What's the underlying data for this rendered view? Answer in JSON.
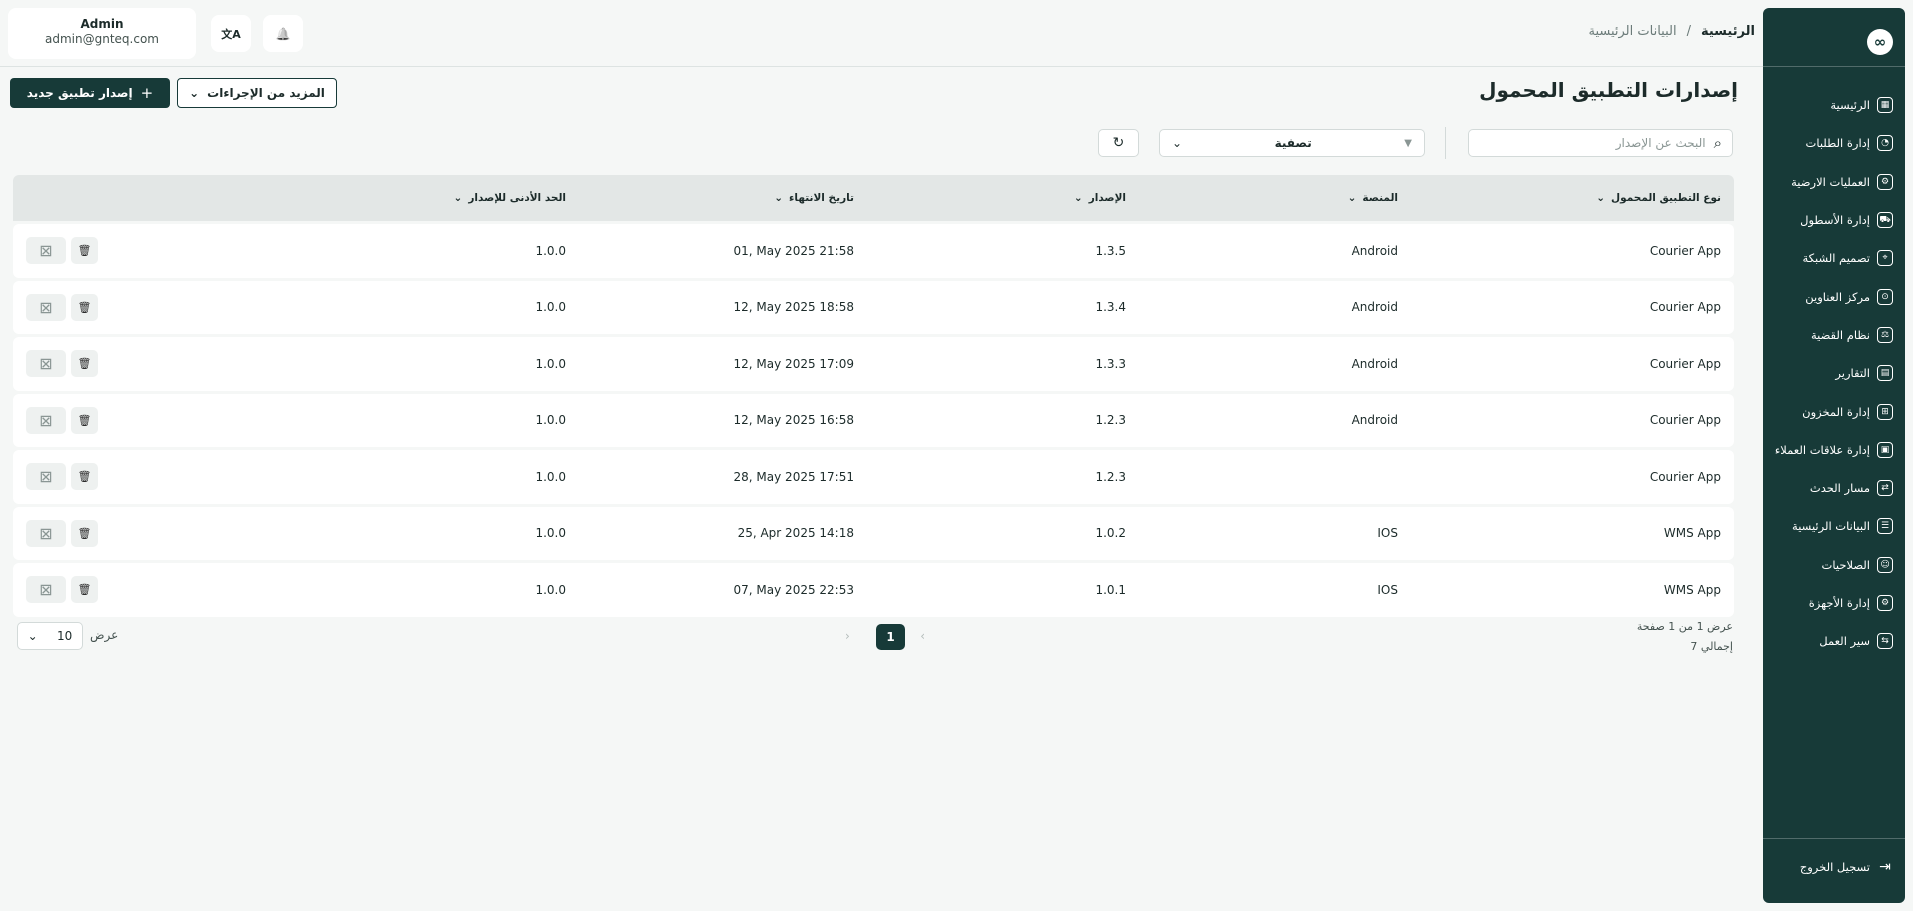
{
  "sidebar": {
    "logo": "∞",
    "items": [
      {
        "label": "الرئيسية",
        "icon": "▦"
      },
      {
        "label": "إدارة الطلبات",
        "icon": "◔"
      },
      {
        "label": "العمليات الارضية",
        "icon": "⚙"
      },
      {
        "label": "إدارة الأسطول",
        "icon": "⛟"
      },
      {
        "label": "تصميم الشبكة",
        "icon": "⌖"
      },
      {
        "label": "مركز العناوين",
        "icon": "⊙"
      },
      {
        "label": "نظام القضية",
        "icon": "⚖"
      },
      {
        "label": "التقارير",
        "icon": "▤"
      },
      {
        "label": "إدارة المخزون",
        "icon": "⊞"
      },
      {
        "label": "إدارة علاقات العملاء",
        "icon": "▣"
      },
      {
        "label": "مسار الحدث",
        "icon": "⇄"
      },
      {
        "label": "البيانات الرئيسية",
        "icon": "☰"
      },
      {
        "label": "الصلاحيات",
        "icon": "☺"
      },
      {
        "label": "إدارة الأجهزة",
        "icon": "⚙"
      },
      {
        "label": "سير العمل",
        "icon": "⇆"
      }
    ],
    "logout": "تسجيل الخروج"
  },
  "breadcrumb": {
    "home": "الرئيسية",
    "sep": "/",
    "current": "البيانات الرئيسية"
  },
  "user": {
    "name": "Admin",
    "email": "admin@gnteq.com"
  },
  "header_icons": {
    "translate": "文A",
    "bell": "🔔"
  },
  "page": {
    "title": "إصدارات التطبيق المحمول",
    "new_button": "إصدار تطبيق جديد",
    "new_icon": "+",
    "more_button": "المزيد من الإجراءات",
    "more_icon": "⌄"
  },
  "toolbar": {
    "search_placeholder": "البحث عن الإصدار",
    "search_icon": "⌕",
    "filter_label": "تصفية",
    "filter_icon": "▼",
    "filter_chevron": "⌄",
    "refresh_icon": "↻"
  },
  "table": {
    "sort_icon": "⌄",
    "headers": {
      "type": "نوع التطبيق المحمول",
      "platform": "المنصة",
      "version": "الإصدار",
      "expiry": "تاريخ الانتهاء",
      "min_version": "الحد الأدنى للإصدار"
    },
    "action_icons": {
      "trash": "🗑",
      "calendar": "⊠"
    },
    "rows": [
      {
        "type": "Courier App",
        "platform": "Android",
        "version": "1.3.5",
        "expiry": "01, May 2025 21:58",
        "min_version": "1.0.0"
      },
      {
        "type": "Courier App",
        "platform": "Android",
        "version": "1.3.4",
        "expiry": "12, May 2025 18:58",
        "min_version": "1.0.0"
      },
      {
        "type": "Courier App",
        "platform": "Android",
        "version": "1.3.3",
        "expiry": "12, May 2025 17:09",
        "min_version": "1.0.0"
      },
      {
        "type": "Courier App",
        "platform": "Android",
        "version": "1.2.3",
        "expiry": "12, May 2025 16:58",
        "min_version": "1.0.0"
      },
      {
        "type": "Courier App",
        "platform": "",
        "version": "1.2.3",
        "expiry": "28, May 2025 17:51",
        "min_version": "1.0.0"
      },
      {
        "type": "WMS App",
        "platform": "IOS",
        "version": "1.0.2",
        "expiry": "25, Apr 2025 14:18",
        "min_version": "1.0.0"
      },
      {
        "type": "WMS App",
        "platform": "IOS",
        "version": "1.0.1",
        "expiry": "07, May 2025 22:53",
        "min_version": "1.0.0"
      }
    ]
  },
  "footer": {
    "showing": "عرض 1 من 1 صفحة",
    "total": "إجمالي 7",
    "current_page": "1",
    "prev_icon": "‹",
    "next_icon": "›",
    "page_size": "10",
    "page_size_icon": "⌄",
    "page_size_label": "عرض"
  }
}
